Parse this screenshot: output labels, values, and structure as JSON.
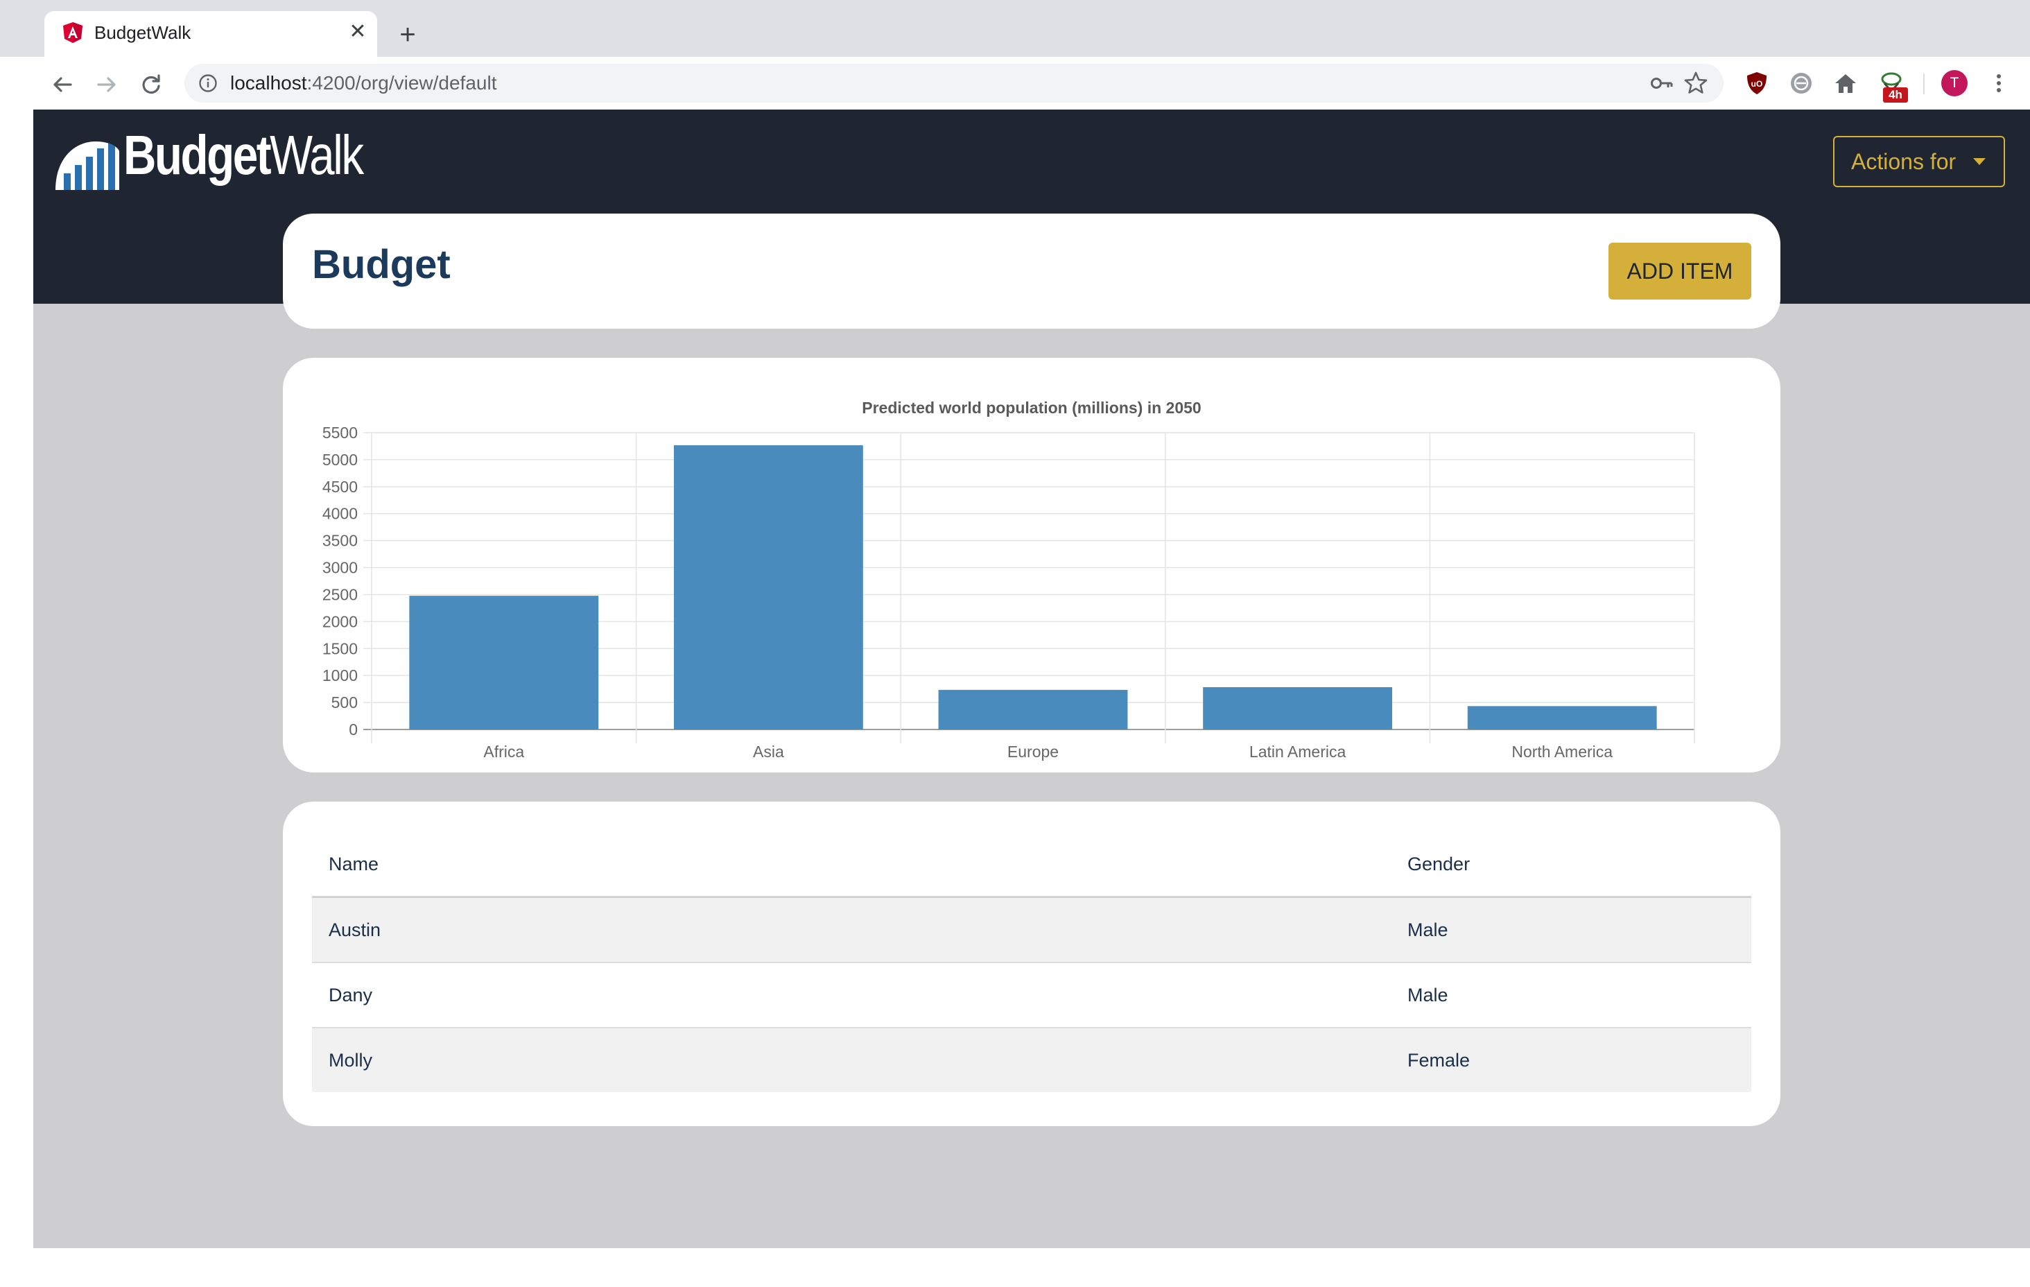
{
  "browser": {
    "tab_title": "BudgetWalk",
    "url_host": "localhost",
    "url_path": ":4200/org/view/default",
    "extension_badge": "4h",
    "avatar_initial": "T"
  },
  "navbar": {
    "logo_budget": "Budget",
    "logo_walk": "Walk",
    "actions_label": "Actions for"
  },
  "header": {
    "title": "Budget",
    "add_item_label": "ADD ITEM"
  },
  "chart_data": {
    "type": "bar",
    "title": "Predicted world population (millions) in 2050",
    "categories": [
      "Africa",
      "Asia",
      "Europe",
      "Latin America",
      "North America"
    ],
    "values": [
      2478,
      5267,
      734,
      784,
      433
    ],
    "ylim": [
      0,
      5500
    ],
    "yticks": [
      0,
      500,
      1000,
      1500,
      2000,
      2500,
      3000,
      3500,
      4000,
      4500,
      5000,
      5500
    ],
    "bar_color": "#4a8bbe",
    "grid": true,
    "legend": "none"
  },
  "table": {
    "headers": {
      "name": "Name",
      "gender": "Gender"
    },
    "rows": [
      {
        "name": "Austin",
        "gender": "Male"
      },
      {
        "name": "Dany",
        "gender": "Male"
      },
      {
        "name": "Molly",
        "gender": "Female"
      }
    ]
  }
}
